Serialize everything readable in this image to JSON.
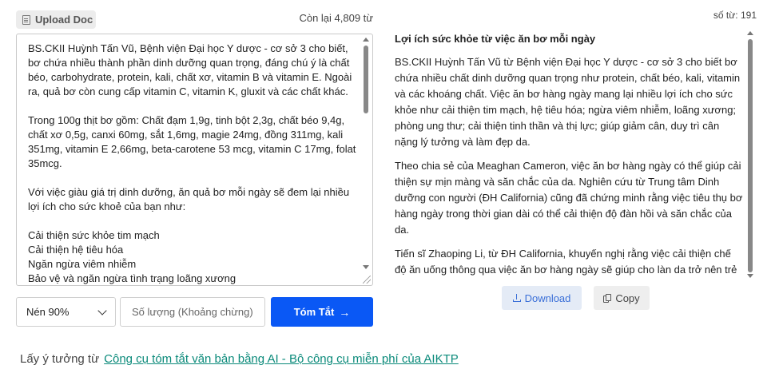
{
  "toolbar": {
    "upload_label": "Upload Doc",
    "remaining": "Còn lại 4,809 từ",
    "word_count": "số từ: 191"
  },
  "input": {
    "text": "BS.CKII Huỳnh Tấn Vũ, Bệnh viện Đại học Y dược - cơ sở 3 cho biết, bơ chứa nhiều thành phần dinh dưỡng quan trọng, đáng chú ý là chất béo, carbohydrate, protein, kali, chất xơ, vitamin B và vitamin E. Ngoài ra, quả bơ còn cung cấp vitamin C, vitamin K, gluxit và các chất khác.\n\nTrong 100g thịt bơ gồm: Chất đạm 1,9g, tinh bột 2,3g, chất béo 9,4g, chất xơ 0,5g, canxi 60mg, sắt 1,6mg, magie 24mg, đồng 311mg, kali 351mg, vitamin E 2,66mg, beta-carotene 53 mcg, vitamin C 17mg, folat 35mcg.\n\nVới việc giàu giá trị dinh dưỡng, ăn quả bơ mỗi ngày sẽ đem lại nhiều lợi ích cho sức khoẻ của bạn như:\n\nCải thiện sức khỏe tim mạch\nCải thiện hệ tiêu hóa\nNgăn ngừa viêm nhiễm\nBảo vệ và ngăn ngừa tình trạng loãng xương\nPhòng ngừa ung thư"
  },
  "controls": {
    "compression": "Nén 90%",
    "quantity_placeholder": "Số lượng (Khoảng chừng)",
    "summarize_label": "Tóm Tắt"
  },
  "output": {
    "title": "Lợi ích sức khỏe từ việc ăn bơ mỗi ngày",
    "paragraphs": [
      "BS.CKII Huỳnh Tấn Vũ từ Bệnh viện Đại học Y dược - cơ sở 3 cho biết bơ chứa nhiều chất dinh dưỡng quan trọng như protein, chất béo, kali, vitamin và các khoáng chất. Việc ăn bơ hàng ngày mang lại nhiều lợi ích cho sức khỏe như cải thiện tim mạch, hệ tiêu hóa; ngừa viêm nhiễm, loãng xương; phòng ung thư; cải thiện tinh thần và thị lực; giúp giảm cân, duy trì cân nặng lý tưởng và làm đẹp da.",
      "Theo chia sẻ của Meaghan Cameron, việc ăn bơ hàng ngày có thể giúp cải thiện sự mịn màng và săn chắc của da. Nghiên cứu từ Trung tâm Dinh dưỡng con người (ĐH California) cũng đã chứng minh rằng việc tiêu thụ bơ hàng ngày trong thời gian dài có thể cải thiện độ đàn hồi và săn chắc của da.",
      "Tiến sĩ Zhaoping Li, từ ĐH California, khuyến nghị rằng việc cải thiện chế độ ăn uống thông qua việc ăn bơ hàng ngày sẽ giúp cho làn da trở nên trẻ trung và khỏe mạnh."
    ],
    "download_label": "Download",
    "copy_label": "Copy"
  },
  "footer": {
    "prefix": "Lấy ý tưởng từ",
    "link_text": "Công cụ tóm tắt văn bản bằng AI - Bộ công cụ miễn phí của AIKTP"
  }
}
